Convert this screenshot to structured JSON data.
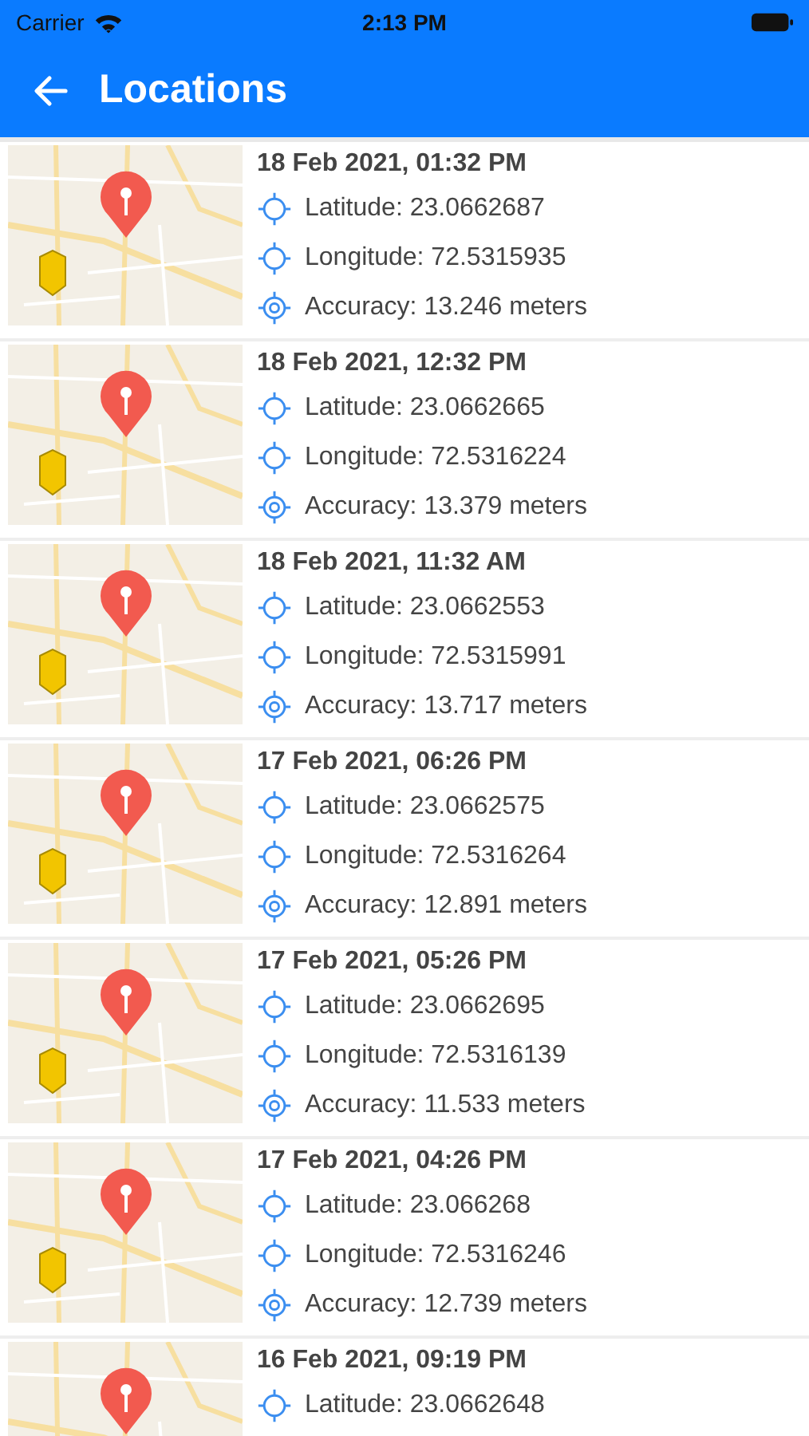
{
  "status_bar": {
    "carrier": "Carrier",
    "time": "2:13 PM"
  },
  "header": {
    "title": "Locations"
  },
  "locations": [
    {
      "time": "18 Feb 2021, 01:32 PM",
      "latitude": "Latitude: 23.0662687",
      "longitude": "Longitude: 72.5315935",
      "accuracy": "Accuracy: 13.246 meters"
    },
    {
      "time": "18 Feb 2021, 12:32 PM",
      "latitude": "Latitude: 23.0662665",
      "longitude": "Longitude: 72.5316224",
      "accuracy": "Accuracy: 13.379 meters"
    },
    {
      "time": "18 Feb 2021, 11:32 AM",
      "latitude": "Latitude: 23.0662553",
      "longitude": "Longitude: 72.5315991",
      "accuracy": "Accuracy: 13.717 meters"
    },
    {
      "time": "17 Feb 2021, 06:26 PM",
      "latitude": "Latitude: 23.0662575",
      "longitude": "Longitude: 72.5316264",
      "accuracy": "Accuracy: 12.891 meters"
    },
    {
      "time": "17 Feb 2021, 05:26 PM",
      "latitude": "Latitude: 23.0662695",
      "longitude": "Longitude: 72.5316139",
      "accuracy": "Accuracy: 11.533 meters"
    },
    {
      "time": "17 Feb 2021, 04:26 PM",
      "latitude": "Latitude: 23.066268",
      "longitude": "Longitude: 72.5316246",
      "accuracy": "Accuracy: 12.739 meters"
    },
    {
      "time": "16 Feb 2021, 09:19 PM",
      "latitude": "Latitude: 23.0662648"
    }
  ]
}
